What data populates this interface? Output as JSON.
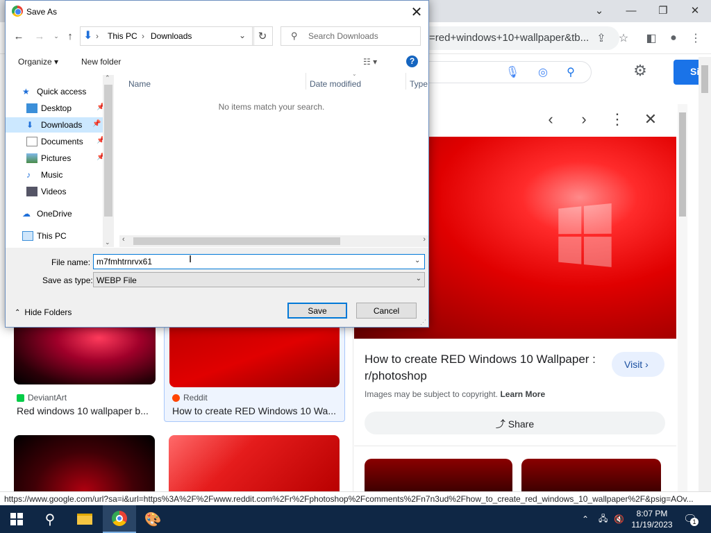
{
  "browser": {
    "address_fragment": "=red+windows+10+wallpaper&tb...",
    "signin_label": "Si",
    "status_url": "https://www.google.com/url?sa=i&url=https%3A%2F%2Fwww.reddit.com%2Fr%2Fphotoshop%2Fcomments%2Fn7n3ud%2Fhow_to_create_red_windows_10_wallpaper%2F&psig=AOv...",
    "side_panel": {
      "title": "How to create RED Windows 10 Wallpaper : r/photoshop",
      "visit_label": "Visit",
      "copyright_text": "Images may be subject to copyright.",
      "learn_more": "Learn More",
      "share_label": "Share"
    },
    "results": [
      {
        "source": "DeviantArt",
        "title": "Red windows 10 wallpaper b..."
      },
      {
        "source": "Reddit",
        "title": "How to create RED Windows 10 Wa..."
      }
    ]
  },
  "dialog": {
    "title": "Save As",
    "breadcrumb": [
      "This PC",
      "Downloads"
    ],
    "search_placeholder": "Search Downloads",
    "organize_label": "Organize",
    "new_folder_label": "New folder",
    "nav_items": [
      {
        "label": "Quick access"
      },
      {
        "label": "Desktop"
      },
      {
        "label": "Downloads"
      },
      {
        "label": "Documents"
      },
      {
        "label": "Pictures"
      },
      {
        "label": "Music"
      },
      {
        "label": "Videos"
      },
      {
        "label": "OneDrive"
      },
      {
        "label": "This PC"
      }
    ],
    "columns": [
      "Name",
      "Date modified",
      "Type"
    ],
    "empty_message": "No items match your search.",
    "file_name_label": "File name:",
    "file_name_value": "m7fmhtrnrvx61",
    "save_type_label": "Save as type:",
    "save_type_value": "WEBP File",
    "save_label": "Save",
    "cancel_label": "Cancel",
    "hide_folders_label": "Hide Folders"
  },
  "taskbar": {
    "time": "8:07 PM",
    "date": "11/19/2023",
    "notification_count": "1"
  },
  "colors": {
    "accent": "#0078d7",
    "taskbar": "#0f2745",
    "google_blue": "#1a73e8",
    "wallpaper_red": "#e00000"
  }
}
